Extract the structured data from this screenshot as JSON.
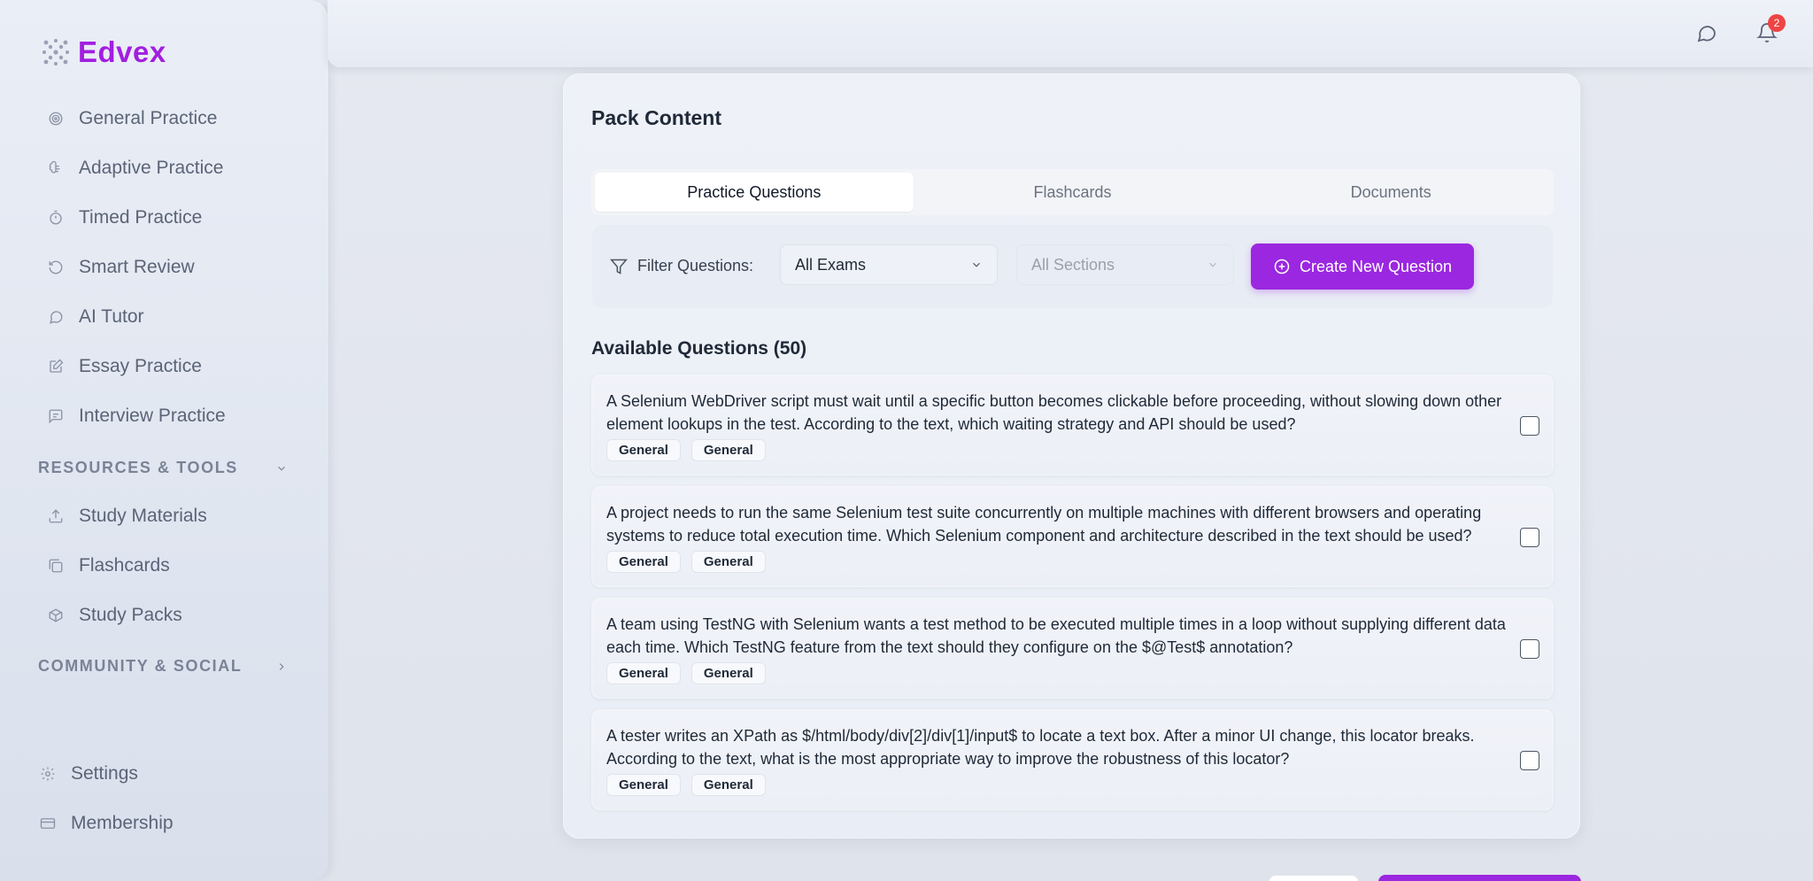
{
  "app": {
    "name": "Edvex",
    "brand_color": "#a21ee0"
  },
  "sidebar": {
    "items": [
      {
        "label": "General Practice",
        "icon": "target-icon"
      },
      {
        "label": "Adaptive Practice",
        "icon": "brain-icon"
      },
      {
        "label": "Timed Practice",
        "icon": "timer-icon"
      },
      {
        "label": "Smart Review",
        "icon": "rotate-icon"
      },
      {
        "label": "AI Tutor",
        "icon": "chat-icon"
      },
      {
        "label": "Essay Practice",
        "icon": "edit-icon"
      },
      {
        "label": "Interview Practice",
        "icon": "message-square-icon"
      }
    ],
    "resources_header": "RESOURCES & TOOLS",
    "resources": [
      {
        "label": "Study Materials",
        "icon": "upload-icon"
      },
      {
        "label": "Flashcards",
        "icon": "cards-icon"
      },
      {
        "label": "Study Packs",
        "icon": "package-icon"
      }
    ],
    "community_header": "COMMUNITY & SOCIAL",
    "bottom": [
      {
        "label": "Settings",
        "icon": "gear-icon"
      },
      {
        "label": "Membership",
        "icon": "credit-card-icon"
      }
    ]
  },
  "topbar": {
    "notification_count": "2"
  },
  "pack": {
    "title": "Pack Content",
    "tabs": [
      "Practice Questions",
      "Flashcards",
      "Documents"
    ],
    "active_tab": "Practice Questions",
    "filter_label": "Filter Questions:",
    "exam_select": "All Exams",
    "section_select": "All Sections",
    "create_button": "Create New Question",
    "accent_color": "#9b27e0",
    "available_title": "Available Questions (50)",
    "questions": [
      {
        "text": "A Selenium WebDriver script must wait until a specific button becomes clickable before proceeding, without slowing down other element lookups in the test. According to the text, which waiting strategy and API should be used?",
        "tags": [
          "General",
          "General"
        ]
      },
      {
        "text": "A project needs to run the same Selenium test suite concurrently on multiple machines with different browsers and operating systems to reduce total execution time. Which Selenium component and architecture described in the text should be used?",
        "tags": [
          "General",
          "General"
        ]
      },
      {
        "text": "A team using TestNG with Selenium wants a test method to be executed multiple times in a loop without supplying different data each time. Which TestNG feature from the text should they configure on the $@Test$ annotation?",
        "tags": [
          "General",
          "General"
        ]
      },
      {
        "text": "A tester writes an XPath as $/html/body/div[2]/div[1]/input$ to locate a text box. After a minor UI change, this locator breaks. According to the text, what is the most appropriate way to improve the robustness of this locator?",
        "tags": [
          "General",
          "General"
        ]
      }
    ]
  }
}
